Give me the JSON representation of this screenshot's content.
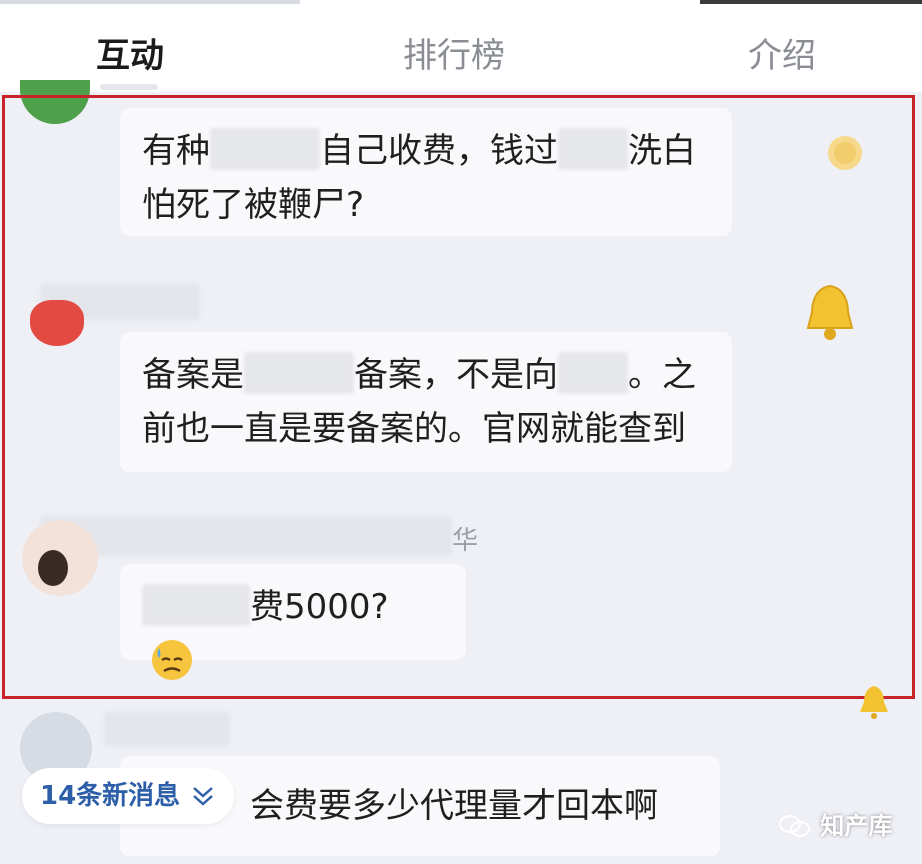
{
  "tabs": [
    {
      "label": "互动",
      "active": true
    },
    {
      "label": "排行榜",
      "active": false
    },
    {
      "label": "介绍",
      "active": false
    }
  ],
  "comments": [
    {
      "line1_a": "有种",
      "line1_b": "自己收费，钱过",
      "line1_c": "洗白",
      "line2": "怕死了被鞭尸?"
    },
    {
      "line1_a": "备案是",
      "line1_b": "备案，不是向",
      "line1_c": "。之",
      "line2": "前也一直是要备案的。官网就能查到"
    },
    {
      "name_tail": "华",
      "text": "费5000?",
      "emoji": "downcast-sweat-face"
    },
    {
      "text": "会费要多少代理量才回本啊"
    }
  ],
  "new_messages": {
    "label": "14条新消息",
    "icon": "chevron-double-down-icon"
  },
  "watermark": {
    "text": "知产库",
    "icon": "wechat-icon"
  },
  "colors": {
    "highlight": "#c8222a",
    "new_msg": "#2d5fa8",
    "gift": "#f2c230"
  }
}
